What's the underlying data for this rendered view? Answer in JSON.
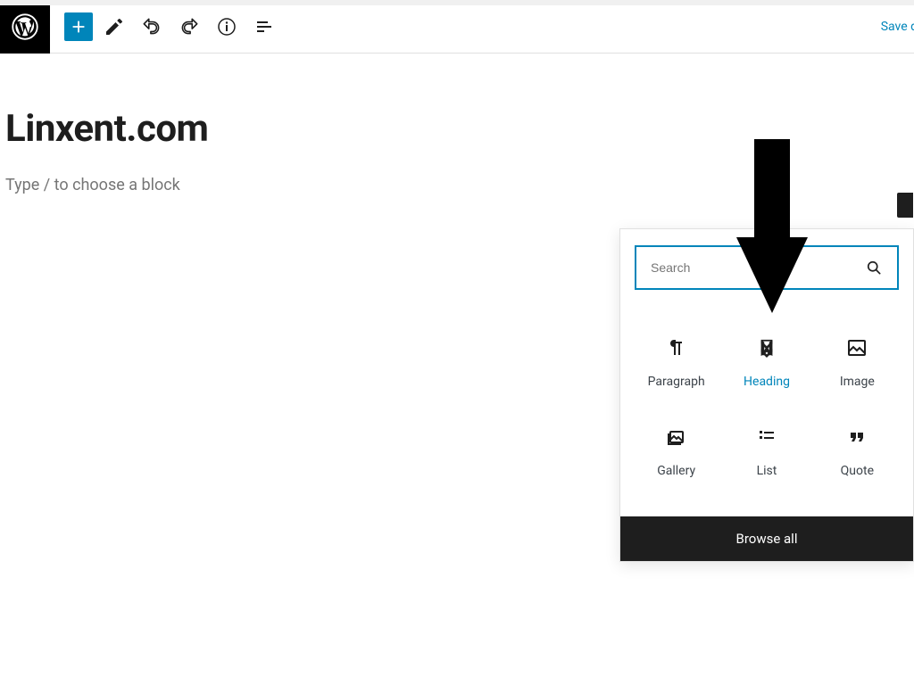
{
  "toolbar": {
    "save_draft": "Save d"
  },
  "editor": {
    "title": "Linxent.com",
    "placeholder": "Type / to choose a block"
  },
  "inserter": {
    "search_placeholder": "Search",
    "blocks": [
      {
        "label": "Paragraph"
      },
      {
        "label": "Heading"
      },
      {
        "label": "Image"
      },
      {
        "label": "Gallery"
      },
      {
        "label": "List"
      },
      {
        "label": "Quote"
      }
    ],
    "browse_all": "Browse all"
  }
}
